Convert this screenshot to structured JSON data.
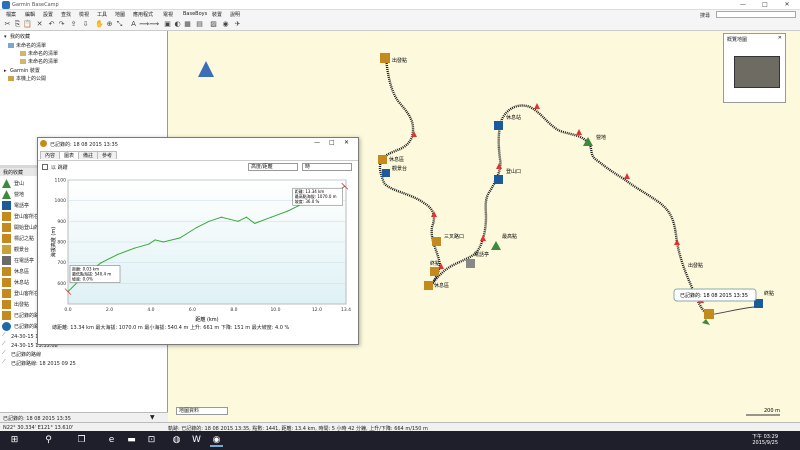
{
  "window": {
    "title": "Garmin BaseCamp",
    "min": "—",
    "max": "□",
    "close": "✕"
  },
  "menu": {
    "items": [
      "檔案",
      "編輯",
      "設置",
      "查找",
      "檢視",
      "工具",
      "地圖",
      "應用程式",
      "電視",
      "BaseBoys",
      "裝置",
      "說明"
    ],
    "search_label": "搜尋"
  },
  "tree": {
    "library_label": "我的收藏",
    "items": [
      "我的收藏",
      "未命名的清單",
      "未命名的清單",
      "Garmin 裝置",
      "本機上的公開"
    ]
  },
  "my_data": {
    "header": "我的收藏",
    "items": [
      "登山",
      "營地",
      "電話亭",
      "登山客所在地",
      "開始登山的點",
      "標記之點",
      "觀景台",
      "在電話亭",
      "休息區",
      "休息站",
      "登山客所在",
      "出發點",
      "已記錄的路線"
    ],
    "tracks": [
      "24-30-15 13:35:08",
      "24-30-15 13:35:08",
      "已記錄的路線",
      "已記錄路線: 18 2015 09 25"
    ],
    "footer": "已記錄的: 18 08 2015 13:35"
  },
  "dialog": {
    "title": "已記錄的: 18 08 2015 13:35",
    "tabs": [
      "內容",
      "圖表",
      "備註",
      "參考"
    ],
    "checkbox_label": "以 跳躍",
    "select_series": "高度/距離",
    "select_x": "時",
    "info": "總距離: 13.34 km    最大海拔: 1070.0 m    最小海拔: 540.4 m    上升: 661 m    下降: 151 m    最大坡度: 4.0 %",
    "tooltip_start": [
      "距離: 0.03 km",
      "最低點海拔: 540.4 m",
      "坡度: 0.0%"
    ],
    "tooltip_end": [
      "距離: 13.34 km",
      "最高點海拔: 1070.0 m",
      "坡度: 36.0 %"
    ]
  },
  "chart_data": {
    "type": "line",
    "xlabel": "距離 (km)",
    "ylabel": "海拔高度 (m)",
    "xlim": [
      0,
      13.4
    ],
    "ylim": [
      500,
      1100
    ],
    "x_ticks": [
      "0.0",
      "2.0",
      "4.0",
      "6.0",
      "8.0",
      "10.0",
      "12.0",
      "13.4"
    ],
    "y_ticks": [
      "600",
      "700",
      "800",
      "900",
      "1000",
      "1100"
    ],
    "series": [
      {
        "name": "",
        "color": "#3aaa3a",
        "x": [
          0.0,
          0.8,
          1.6,
          2.4,
          3.2,
          3.9,
          4.2,
          4.6,
          5.4,
          6.2,
          6.8,
          7.4,
          7.8,
          8.2,
          8.6,
          9.0,
          9.8,
          10.6,
          11.2,
          11.8,
          12.4,
          13.0,
          13.34
        ],
        "values": [
          560,
          640,
          700,
          740,
          770,
          790,
          810,
          800,
          820,
          870,
          900,
          920,
          910,
          900,
          920,
          890,
          920,
          950,
          980,
          1000,
          1020,
          1045,
          1070
        ]
      }
    ]
  },
  "map": {
    "waypoints": [
      "出發點",
      "休息區",
      "觀景台",
      "休息站",
      "營地",
      "登山口",
      "三叉路口",
      "最高點",
      "終點",
      "電話亭",
      "終點",
      "出發點"
    ],
    "track_color": "#1a1a1a",
    "balloon": "已記錄的: 18 08 2015 13:35",
    "scale": "200 m",
    "layer_select": "地圖資料"
  },
  "overview": {
    "title": "概覽地圖"
  },
  "statusbar": {
    "coords": "N22° 30.334' E121° 13.610'",
    "text": "軌跡: 已記錄的: 18 08 2015 13:35, 點數: 1441, 距離: 13.4 km, 時間: 5 小時 42 分鐘, 上升/下降: 664 m/150 m"
  },
  "taskbar": {
    "clock_time": "下午 03:29",
    "clock_date": "2015/9/25"
  },
  "colors": {
    "map_bg": "#fcf9dc",
    "chart_bg": "#dff1f5",
    "accent": "#2f6fb5"
  }
}
